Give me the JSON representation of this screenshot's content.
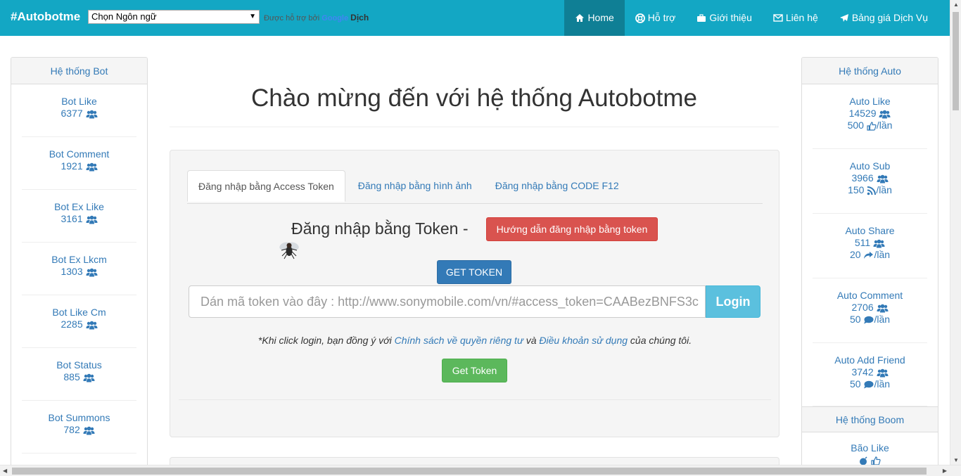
{
  "navbar": {
    "brand": "#Autobotme",
    "language_select": "Chọn Ngôn ngữ",
    "powered_by": "Được hỗ trợ bởi",
    "google": "Google",
    "translate": "Dịch",
    "items": [
      {
        "label": "Home",
        "icon": "home-icon",
        "active": true
      },
      {
        "label": "Hỗ trợ",
        "icon": "lifebuoy-icon"
      },
      {
        "label": "Giới thiệu",
        "icon": "briefcase-icon"
      },
      {
        "label": "Liên hệ",
        "icon": "envelope-icon"
      },
      {
        "label": "Bảng giá Dịch Vụ",
        "icon": "paper-plane-icon"
      }
    ],
    "color": "#13a7c4"
  },
  "left_panel": {
    "title": "Hệ thống Bot",
    "items": [
      {
        "label": "Bot Like",
        "count": "6377"
      },
      {
        "label": "Bot Comment",
        "count": "1921"
      },
      {
        "label": "Bot Ex Like",
        "count": "3161"
      },
      {
        "label": "Bot Ex Lkcm",
        "count": "1303"
      },
      {
        "label": "Bot Like Cm",
        "count": "2285"
      },
      {
        "label": "Bot Status",
        "count": "885"
      },
      {
        "label": "Bot Summons",
        "count": "782"
      }
    ]
  },
  "right_panel": {
    "title": "Hệ thống Auto",
    "items": [
      {
        "label": "Auto Like",
        "count": "14529",
        "rate": "500",
        "rate_icon": "thumbs-up-icon",
        "suffix": "/lần"
      },
      {
        "label": "Auto Sub",
        "count": "3966",
        "rate": "150",
        "rate_icon": "rss-icon",
        "suffix": "/lần"
      },
      {
        "label": "Auto Share",
        "count": "511",
        "rate": "20",
        "rate_icon": "share-icon",
        "suffix": "/lần"
      },
      {
        "label": "Auto Comment",
        "count": "2706",
        "rate": "50",
        "rate_icon": "comment-icon",
        "suffix": "/lần"
      },
      {
        "label": "Auto Add Friend",
        "count": "3742",
        "rate": "50",
        "rate_icon": "comment-icon",
        "suffix": "/lần"
      }
    ],
    "boom_title": "Hệ thống Boom",
    "boom_item": "Bão Like"
  },
  "main": {
    "title": "Chào mừng đến với hệ thống Autobotme",
    "tabs": [
      {
        "label": "Đăng nhập bằng Access Token",
        "active": true
      },
      {
        "label": "Đăng nhập bằng hình ảnh"
      },
      {
        "label": "Đăng nhập bằng CODE F12"
      }
    ],
    "token_heading": "Đăng nhập bằng Token -",
    "guide_button": "Hướng dẫn đăng nhập bằng token",
    "get_token_top": "GET TOKEN",
    "token_placeholder": "Dán mã token vào đây : http://www.sonymobile.com/vn/#access_token=CAABezBNFS3c",
    "login_button": "Login",
    "terms": {
      "prefix": "*Khi click login, bạn đồng ý với ",
      "privacy": "Chính sách về quyền riêng tư",
      "and": " và ",
      "tos": "Điều khoản sử dụng",
      "suffix": " của chúng tôi."
    },
    "get_token_bottom": "Get Token"
  }
}
